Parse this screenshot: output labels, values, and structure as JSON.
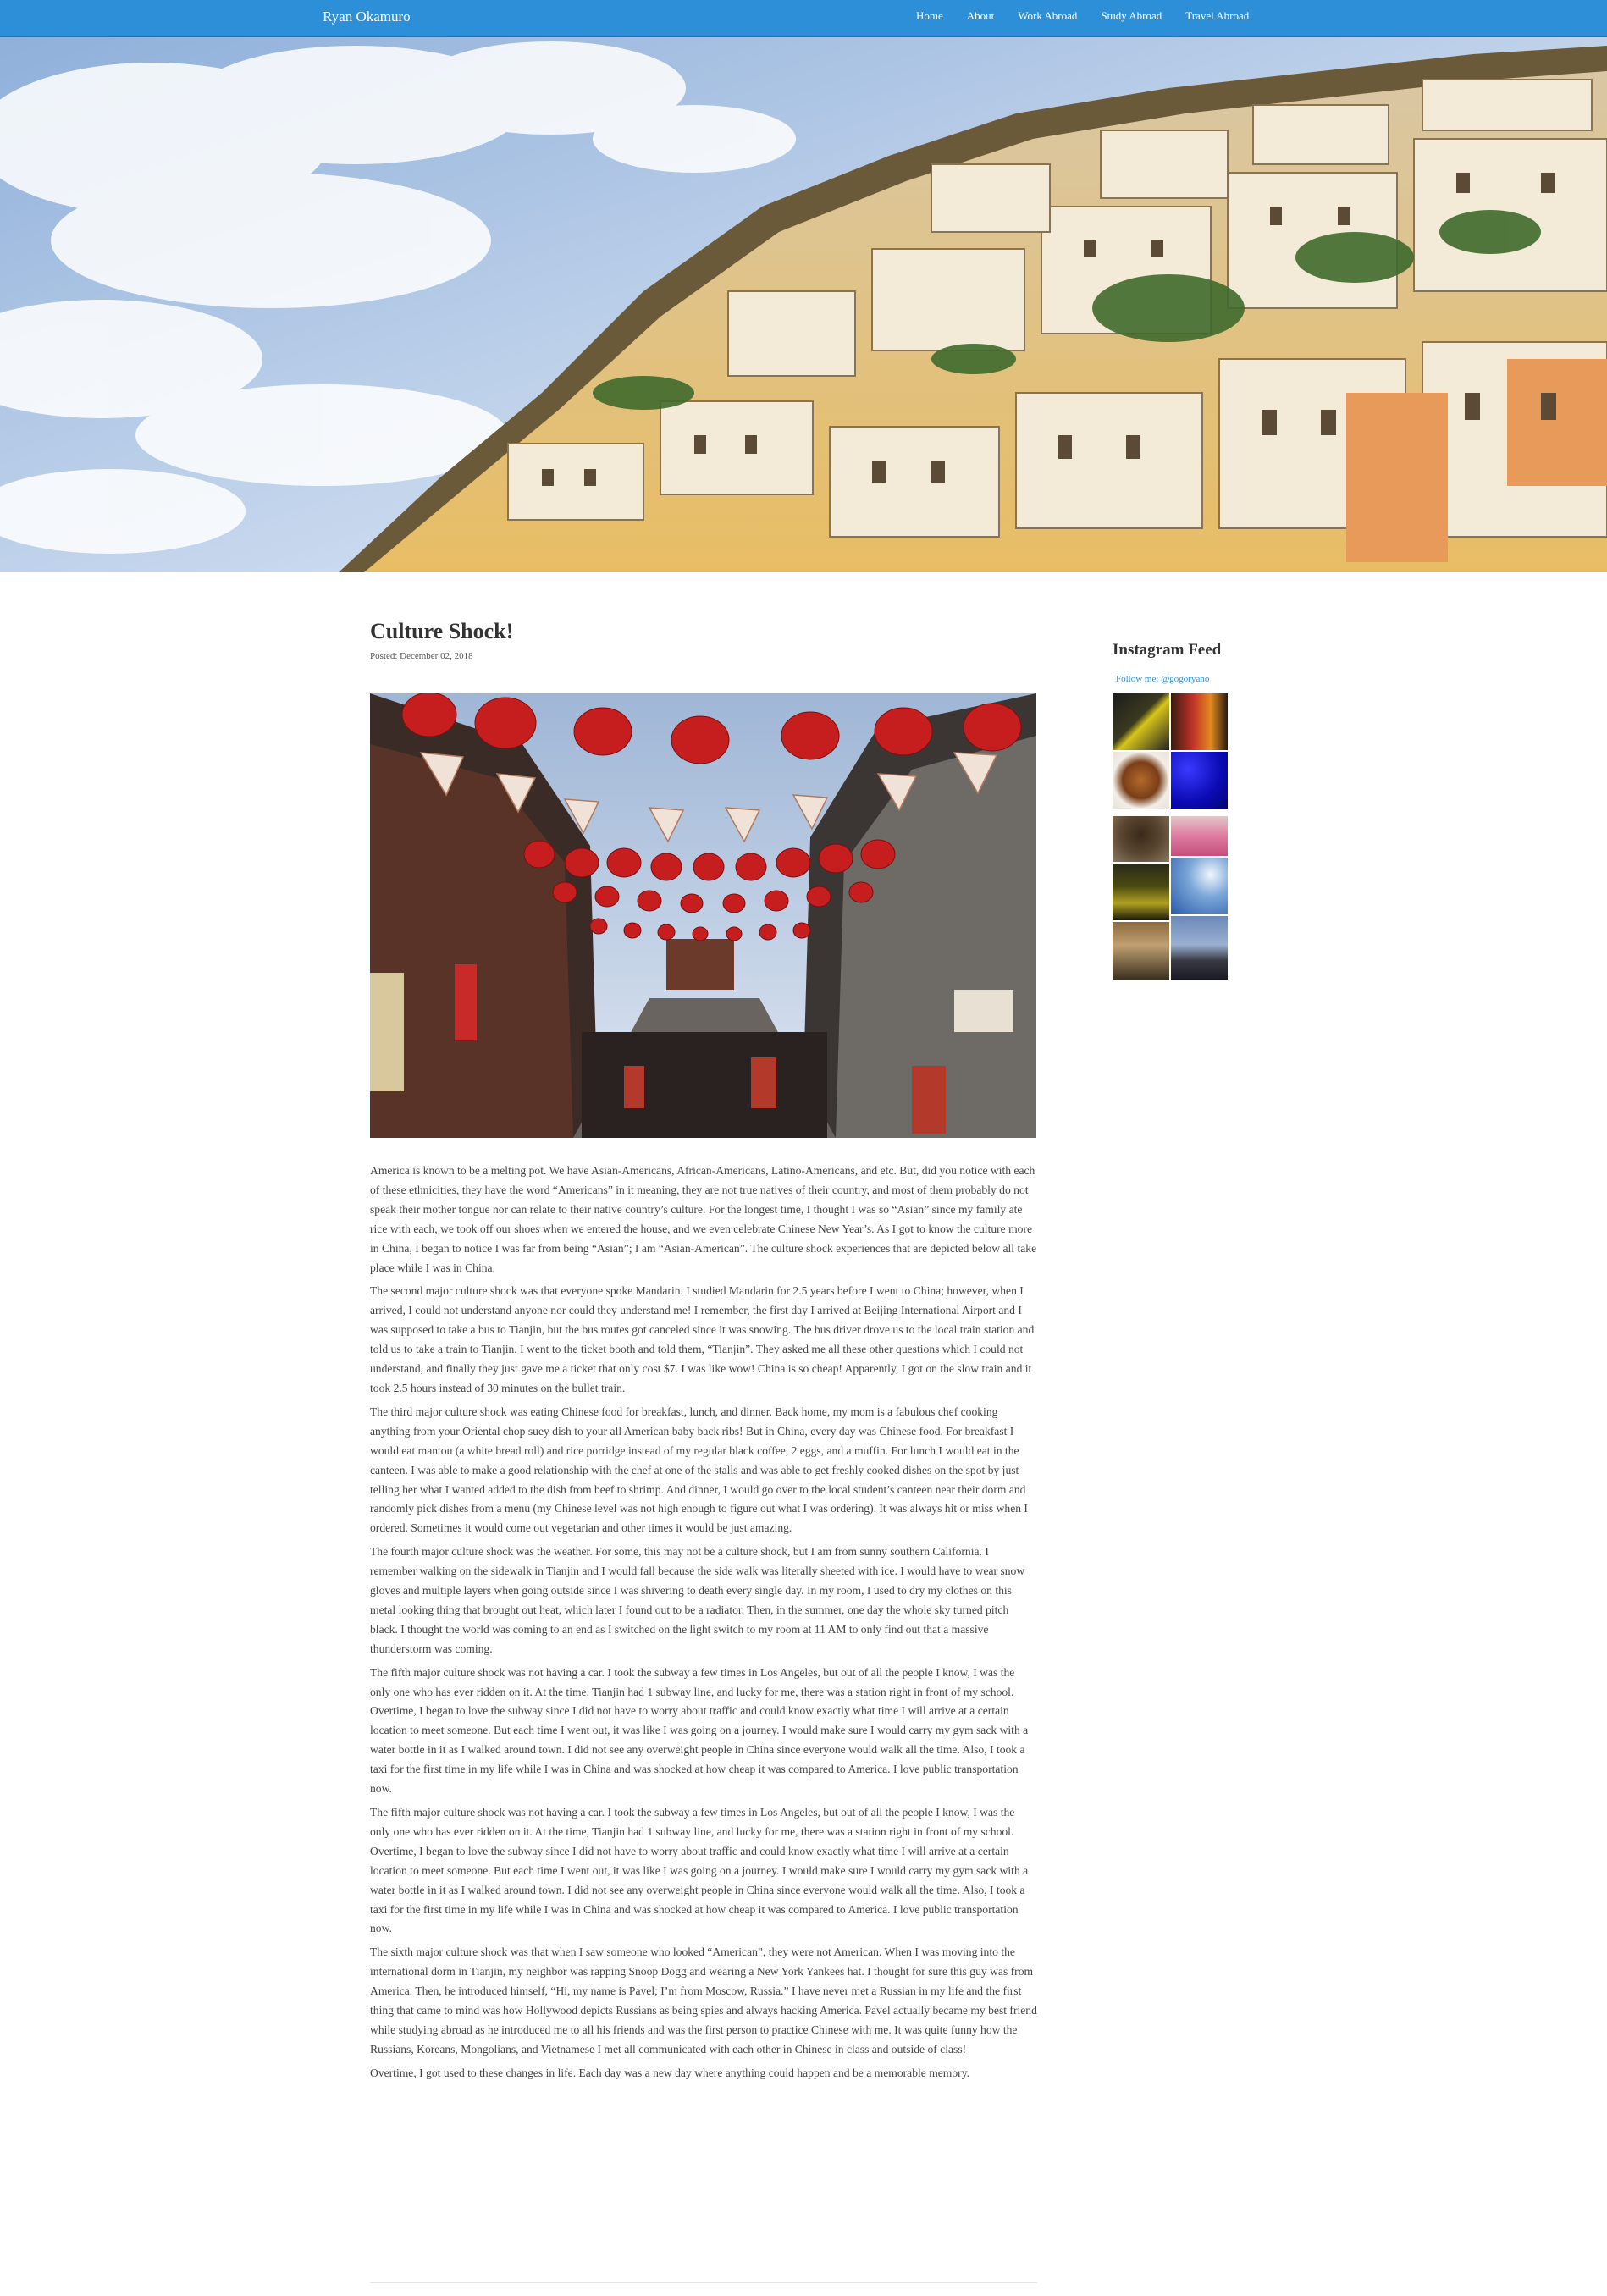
{
  "navbar": {
    "brand": "Ryan Okamuro",
    "links": [
      "Home",
      "About",
      "Work Abroad",
      "Study Abroad",
      "Travel Abroad"
    ]
  },
  "post": {
    "title": "Culture Shock!",
    "posted_label": "Posted:",
    "posted_date": "December 02, 2018",
    "paragraphs": [
      "America is known to be a melting pot. We have Asian-Americans, African-Americans, Latino-Americans, and etc. But, did you notice with each of these ethnicities, they have the word “Americans” in it meaning, they are not true natives of their country, and most of them probably do not speak their mother tongue nor can relate to their native country’s culture. For the longest time, I thought I was so “Asian” since my family ate rice with each, we took off our shoes when we entered the house, and we even celebrate Chinese New Year’s. As I got to know the culture more in China, I began to notice I was far from being “Asian”; I am “Asian-American”. The culture shock experiences that are depicted below all take place while I was in China.",
      "The second major culture shock was that everyone spoke Mandarin. I studied Mandarin for 2.5 years before I went to China; however, when I arrived, I could not understand anyone nor could they understand me! I remember, the first day I arrived at Beijing International Airport and I was supposed to take a bus to Tianjin, but the bus routes got canceled since it was snowing. The bus driver drove us to the local train station and told us to take a train to Tianjin. I went to the ticket booth and told them, “Tianjin”. They asked me all these other questions which I could not understand, and finally they just gave me a ticket that only cost $7. I was like wow! China is so cheap! Apparently, I got on the slow train and it took 2.5 hours instead of 30 minutes on the bullet train.",
      "The third major culture shock was eating Chinese food for breakfast, lunch, and dinner. Back home, my mom is a fabulous chef cooking anything from your Oriental chop suey dish to your all American baby back ribs! But in China, every day was Chinese food. For breakfast I would eat mantou (a white bread roll) and rice porridge instead of my regular black coffee, 2 eggs, and a muffin. For lunch I would eat in the canteen. I was able to make a good relationship with the chef at one of the stalls and was able to get freshly cooked dishes on the spot by just telling her what I wanted added to the dish from beef to shrimp. And dinner, I would go over to the local student’s canteen near their dorm and randomly pick dishes from a menu (my Chinese level was not high enough to figure out what I was ordering). It was always hit or miss when I ordered. Sometimes it would come out vegetarian and other times it would be just amazing.",
      "The fourth major culture shock was the weather. For some, this may not be a culture shock, but I am from sunny southern California. I remember walking on the sidewalk in Tianjin and I would fall because the side walk was literally sheeted with ice. I would have to wear snow gloves and multiple layers when going outside since I was shivering to death every single day. In my room, I used to dry my clothes on this metal looking thing that brought out heat, which later I found out to be a radiator. Then, in the summer, one day the whole sky turned pitch black. I thought the world was coming to an end as I switched on the light switch to my room at 11 AM to only find out that a massive thunderstorm was coming.",
      "The fifth major culture shock was not having a car. I took the subway a few times in Los Angeles, but out of all the people I know, I was the only one who has ever ridden on it. At the time, Tianjin had 1 subway line, and lucky for me, there was a station right in front of my school. Overtime, I began to love the subway since I did not have to worry about traffic and could know exactly what time I will arrive at a certain location to meet someone. But each time I went out, it was like I was going on a journey. I would make sure I would carry my gym sack with a water bottle in it as I walked around town. I did not see any overweight people in China since everyone would walk all the time. Also, I took a taxi for the first time in my life while I was in China and was shocked at how cheap it was compared to America. I love public transportation now.",
      "The fifth major culture shock was not having a car. I took the subway a few times in Los Angeles, but out of all the people I know, I was the only one who has ever ridden on it. At the time, Tianjin had 1 subway line, and lucky for me, there was a station right in front of my school. Overtime, I began to love the subway since I did not have to worry about traffic and could know exactly what time I will arrive at a certain location to meet someone. But each time I went out, it was like I was going on a journey. I would make sure I would carry my gym sack with a water bottle in it as I walked around town. I did not see any overweight people in China since everyone would walk all the time. Also, I took a taxi for the first time in my life while I was in China and was shocked at how cheap it was compared to America. I love public transportation now.",
      "The sixth major culture shock was that when I saw someone who looked “American”, they were not American. When I was moving into the international dorm in Tianjin, my neighbor was rapping Snoop Dogg and wearing a New York Yankees hat. I thought for sure this guy was from America. Then, he introduced himself, “Hi, my name is Pavel; I’m from Moscow, Russia.” I have never met a Russian in my life and the first thing that came to mind was how Hollywood depicts Russians as being spies and always hacking America. Pavel actually became my best friend while studying abroad as he introduced me to all his friends and was the first person to practice Chinese with me. It was quite funny how the Russians, Koreans, Mongolians, and Vietnamese I met all communicated with each other in Chinese in class and outside of class!",
      "Overtime, I got used to these changes in life. Each day was a new day where anything could happen and be a memorable memory."
    ]
  },
  "sidebar": {
    "title": "Instagram Feed",
    "follow_text": "Follow me: @gogoryano"
  },
  "colors": {
    "navbar": "#2d8fd8",
    "link": "#2d8fd8",
    "text": "#444444",
    "heading": "#333333"
  }
}
